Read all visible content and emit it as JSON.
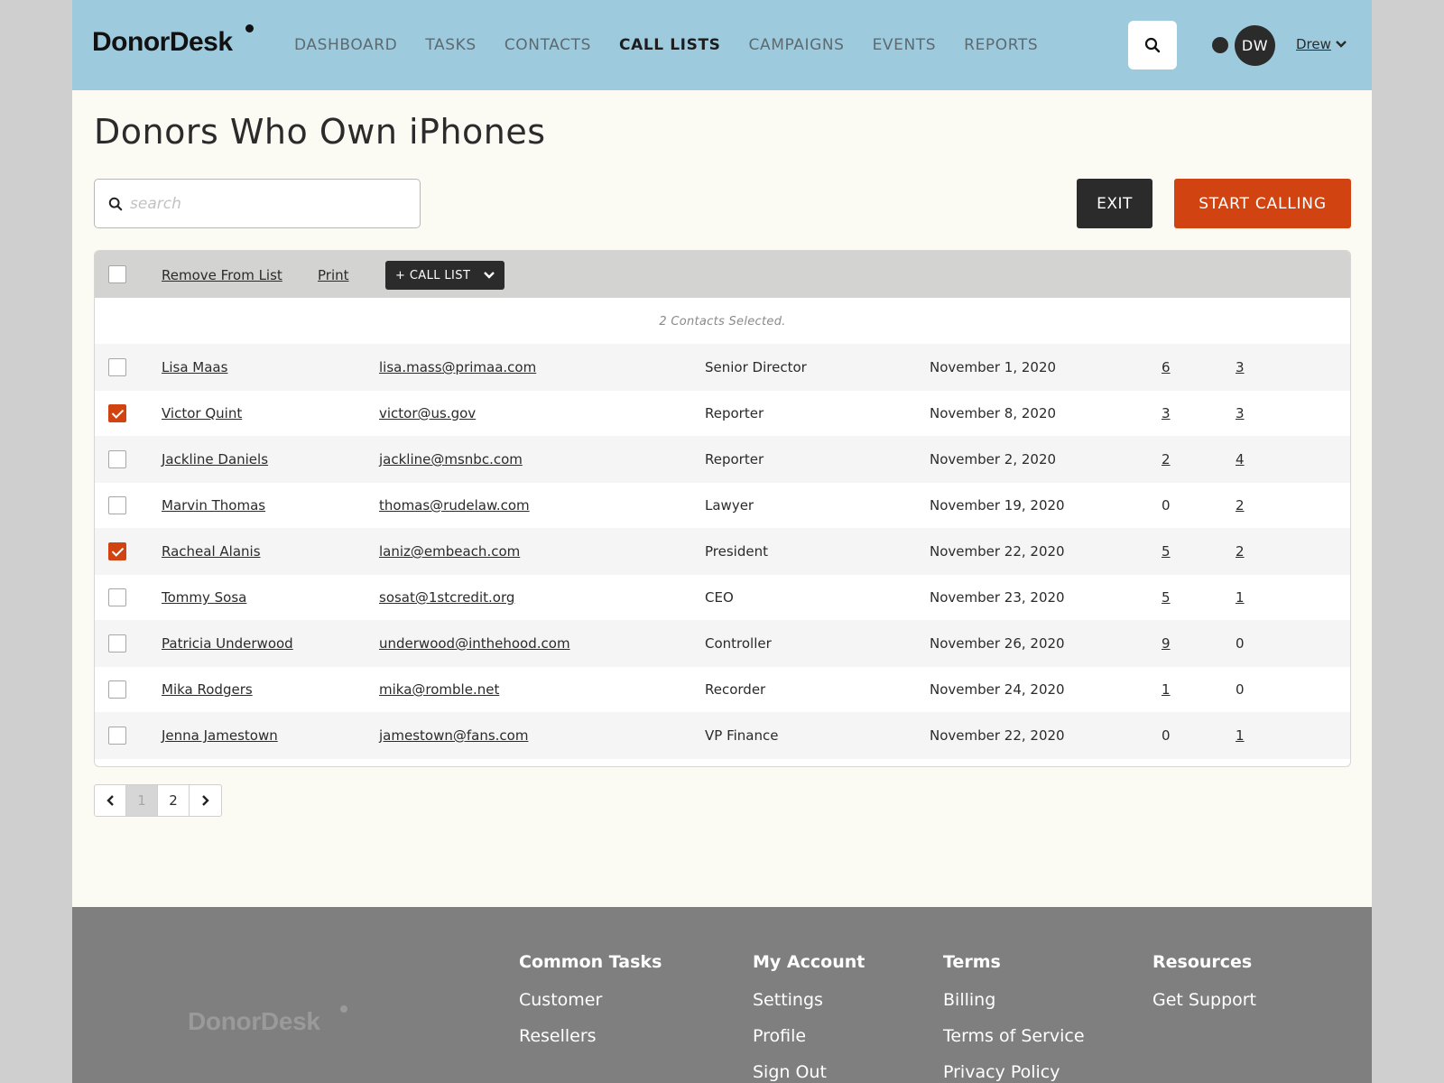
{
  "header": {
    "logo": "DonorDesk",
    "nav": [
      "DASHBOARD",
      "TASKS",
      "CONTACTS",
      "CALL LISTS",
      "CAMPAIGNS",
      "EVENTS",
      "REPORTS"
    ],
    "active_nav": "CALL LISTS",
    "avatar_initials": "DW",
    "user_name": "Drew"
  },
  "page": {
    "title": "Donors Who Own iPhones",
    "search_placeholder": "search",
    "exit_label": "EXIT",
    "start_label": "START CALLING"
  },
  "toolbar": {
    "remove_label": "Remove From List",
    "print_label": "Print",
    "call_list_label": "+ CALL LIST",
    "selected_message": "2 Contacts Selected."
  },
  "contacts": [
    {
      "name": "Lisa Maas",
      "email": "lisa.mass@primaa.com",
      "title": "Senior Director",
      "date": "November 1, 2020",
      "count_a": "6",
      "count_b": "3",
      "checked": false
    },
    {
      "name": "Victor Quint",
      "email": "victor@us.gov",
      "title": "Reporter",
      "date": "November 8, 2020",
      "count_a": "3",
      "count_b": "3",
      "checked": true
    },
    {
      "name": "Jackline Daniels",
      "email": "jackline@msnbc.com",
      "title": "Reporter",
      "date": "November 2, 2020",
      "count_a": "2",
      "count_b": "4",
      "checked": false
    },
    {
      "name": "Marvin Thomas",
      "email": "thomas@rudelaw.com",
      "title": "Lawyer",
      "date": "November 19, 2020",
      "count_a": "0",
      "count_b": "2",
      "checked": false
    },
    {
      "name": "Racheal Alanis",
      "email": "laniz@embeach.com",
      "title": "President",
      "date": "November 22, 2020",
      "count_a": "5",
      "count_b": "2",
      "checked": true
    },
    {
      "name": "Tommy Sosa",
      "email": "sosat@1stcredit.org",
      "title": "CEO",
      "date": "November 23, 2020",
      "count_a": "5",
      "count_b": "1",
      "checked": false
    },
    {
      "name": "Patricia Underwood",
      "email": "underwood@inthehood.com",
      "title": "Controller",
      "date": "November 26, 2020",
      "count_a": "9",
      "count_b": "0",
      "checked": false
    },
    {
      "name": "Mika Rodgers",
      "email": "mika@romble.net",
      "title": "Recorder",
      "date": "November 24, 2020",
      "count_a": "1",
      "count_b": "0",
      "checked": false
    },
    {
      "name": "Jenna Jamestown",
      "email": "jamestown@fans.com",
      "title": "VP Finance",
      "date": "November 22, 2020",
      "count_a": "0",
      "count_b": "1",
      "checked": false
    }
  ],
  "pagination": {
    "pages": [
      "1",
      "2"
    ],
    "current": "1"
  },
  "footer": {
    "logo": "DonorDesk",
    "columns": [
      {
        "heading": "Common Tasks",
        "links": [
          "Customer",
          "Resellers"
        ]
      },
      {
        "heading": "My Account",
        "links": [
          "Settings",
          "Profile",
          "Sign Out"
        ]
      },
      {
        "heading": "Terms",
        "links": [
          "Billing",
          "Terms of Service",
          "Privacy Policy"
        ]
      },
      {
        "heading": "Resources",
        "links": [
          "Get Support"
        ]
      }
    ]
  },
  "colors": {
    "header_bg": "#9ecadd",
    "accent": "#d14411",
    "dark": "#2b2b2b",
    "footer_bg": "#7f7f7f"
  }
}
